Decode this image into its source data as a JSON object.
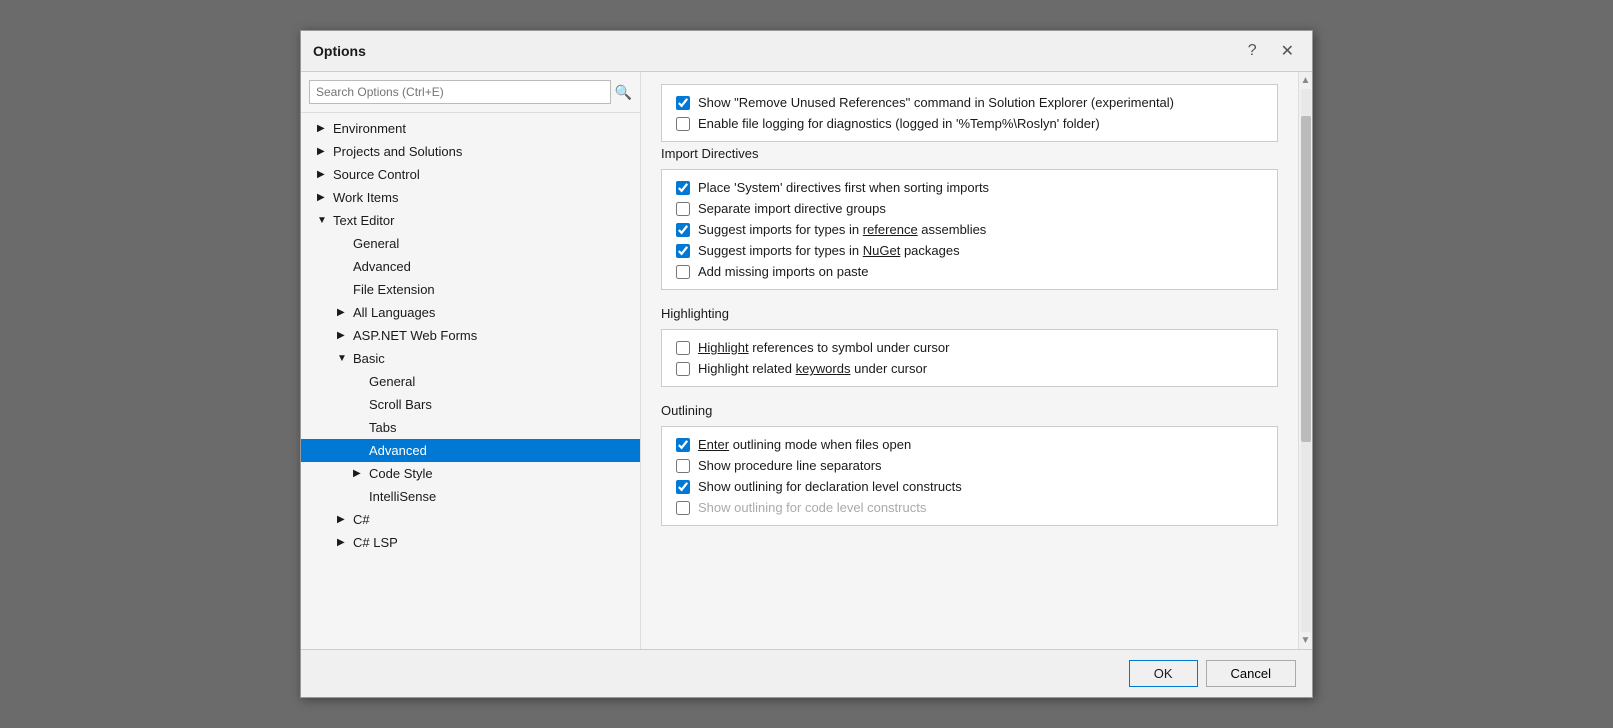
{
  "dialog": {
    "title": "Options",
    "help_btn": "?",
    "close_btn": "✕"
  },
  "search": {
    "placeholder": "Search Options (Ctrl+E)"
  },
  "sidebar": {
    "items": [
      {
        "id": "environment",
        "label": "Environment",
        "level": 0,
        "arrow": "▶",
        "expanded": false
      },
      {
        "id": "projects-solutions",
        "label": "Projects and Solutions",
        "level": 0,
        "arrow": "▶",
        "expanded": false
      },
      {
        "id": "source-control",
        "label": "Source Control",
        "level": 0,
        "arrow": "▶",
        "expanded": false
      },
      {
        "id": "work-items",
        "label": "Work Items",
        "level": 0,
        "arrow": "▶",
        "expanded": false
      },
      {
        "id": "text-editor",
        "label": "Text Editor",
        "level": 0,
        "arrow": "▼",
        "expanded": true
      },
      {
        "id": "general",
        "label": "General",
        "level": 1,
        "arrow": ""
      },
      {
        "id": "advanced",
        "label": "Advanced",
        "level": 1,
        "arrow": ""
      },
      {
        "id": "file-extension",
        "label": "File Extension",
        "level": 1,
        "arrow": ""
      },
      {
        "id": "all-languages",
        "label": "All Languages",
        "level": 1,
        "arrow": "▶"
      },
      {
        "id": "aspnet-web-forms",
        "label": "ASP.NET Web Forms",
        "level": 1,
        "arrow": "▶"
      },
      {
        "id": "basic",
        "label": "Basic",
        "level": 1,
        "arrow": "▼",
        "expanded": true
      },
      {
        "id": "basic-general",
        "label": "General",
        "level": 2,
        "arrow": ""
      },
      {
        "id": "scroll-bars",
        "label": "Scroll Bars",
        "level": 2,
        "arrow": ""
      },
      {
        "id": "tabs",
        "label": "Tabs",
        "level": 2,
        "arrow": ""
      },
      {
        "id": "advanced-selected",
        "label": "Advanced",
        "level": 2,
        "arrow": "",
        "selected": true
      },
      {
        "id": "code-style",
        "label": "Code Style",
        "level": 2,
        "arrow": "▶"
      },
      {
        "id": "intellisense",
        "label": "IntelliSense",
        "level": 2,
        "arrow": ""
      },
      {
        "id": "csharp",
        "label": "C#",
        "level": 1,
        "arrow": "▶"
      },
      {
        "id": "csharp-lsp",
        "label": "C# LSP",
        "level": 1,
        "arrow": "▶"
      }
    ]
  },
  "content": {
    "top_checkboxes": [
      {
        "id": "show-remove-unused",
        "label": "Show \"Remove Unused References\" command in Solution Explorer (experimental)",
        "checked": true
      },
      {
        "id": "enable-file-logging",
        "label": "Enable file logging for diagnostics (logged in '%Temp%\\Roslyn' folder)",
        "checked": false
      }
    ],
    "sections": [
      {
        "id": "import-directives",
        "header": "Import Directives",
        "items": [
          {
            "id": "place-system-first",
            "label": "Place 'System' directives first when sorting imports",
            "checked": true,
            "underline_char": ""
          },
          {
            "id": "separate-groups",
            "label": "Separate import directive groups",
            "checked": false
          },
          {
            "id": "suggest-reference",
            "label": "Suggest imports for types in reference assemblies",
            "checked": true,
            "underline": "reference"
          },
          {
            "id": "suggest-nuget",
            "label": "Suggest imports for types in NuGet packages",
            "checked": true,
            "underline": "NuGet"
          },
          {
            "id": "add-missing",
            "label": "Add missing imports on paste",
            "checked": false
          }
        ]
      },
      {
        "id": "highlighting",
        "header": "Highlighting",
        "items": [
          {
            "id": "highlight-references",
            "label": "Highlight references to symbol under cursor",
            "checked": false,
            "underline": "Highlight"
          },
          {
            "id": "highlight-keywords",
            "label": "Highlight related keywords under cursor",
            "checked": false,
            "underline": "keywords"
          }
        ]
      },
      {
        "id": "outlining",
        "header": "Outlining",
        "items": [
          {
            "id": "enter-outlining",
            "label": "Enter outlining mode when files open",
            "checked": true,
            "underline": "Enter"
          },
          {
            "id": "show-procedure",
            "label": "Show procedure line separators",
            "checked": false
          },
          {
            "id": "show-outlining-declaration",
            "label": "Show outlining for declaration level constructs",
            "checked": true
          },
          {
            "id": "show-outlining-code",
            "label": "Show outlining for code level constructs",
            "checked": false
          }
        ]
      }
    ]
  },
  "footer": {
    "ok_label": "OK",
    "cancel_label": "Cancel"
  }
}
